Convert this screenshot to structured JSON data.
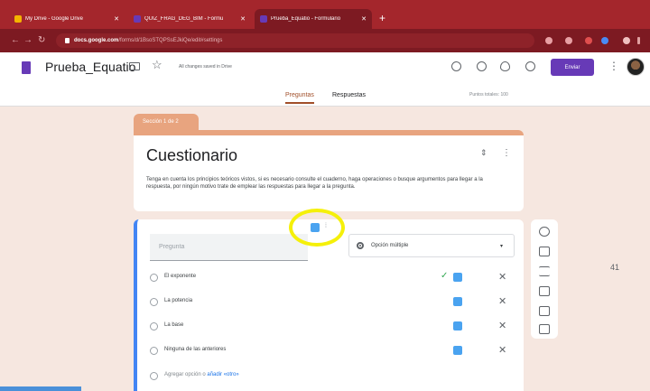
{
  "browser": {
    "tabs": [
      {
        "title": "My Drive - Google Drive",
        "fav_color": "#f4b400"
      },
      {
        "title": "QUIZ_FRAG_DEG_BIM - Formu",
        "fav_color": "#673ab7"
      },
      {
        "title": "Prueba_Equatio - Formulario",
        "fav_color": "#673ab7"
      }
    ],
    "new_tab": "+",
    "url_host": "docs.google.com",
    "url_path": "/forms/d/1BsoSTQPSsEJkiQe/edit#settings"
  },
  "header": {
    "doc_title": "Prueba_Equatio",
    "saved_status": "All changes saved in Drive",
    "send_label": "Enviar"
  },
  "form_tabs": {
    "questions": "Preguntas",
    "responses": "Respuestas",
    "points": "Puntos totales: 100"
  },
  "section": {
    "tag": "Sección 1 de 2",
    "title": "Cuestionario",
    "description": "Tenga en cuenta los principios teóricos vistos, si es necesario consulte el cuaderno, haga operaciones o busque argumentos para llegar a la respuesta, por ningún motivo trate de emplear las respuestas para llegar a la pregunta."
  },
  "question": {
    "placeholder": "Pregunta",
    "type_label": "Opción múltiple",
    "options": [
      {
        "label": "El exponente",
        "correct": true
      },
      {
        "label": "La potencia",
        "correct": false
      },
      {
        "label": "La base",
        "correct": false
      },
      {
        "label": "Ninguna de las anteriores",
        "correct": false
      }
    ],
    "add_option": "Agregar opción o",
    "add_other": "añadir «otro»"
  },
  "icons": {
    "remove": "✕",
    "check": "✓",
    "caret": "▾",
    "star": "☆",
    "kebab": "⋮",
    "grip": "⁞"
  },
  "colors": {
    "accent": "#673ab7",
    "theme": "#e8a47f",
    "background": "#f6e7e0",
    "highlight": "#f5f00a"
  },
  "page_number": "41"
}
